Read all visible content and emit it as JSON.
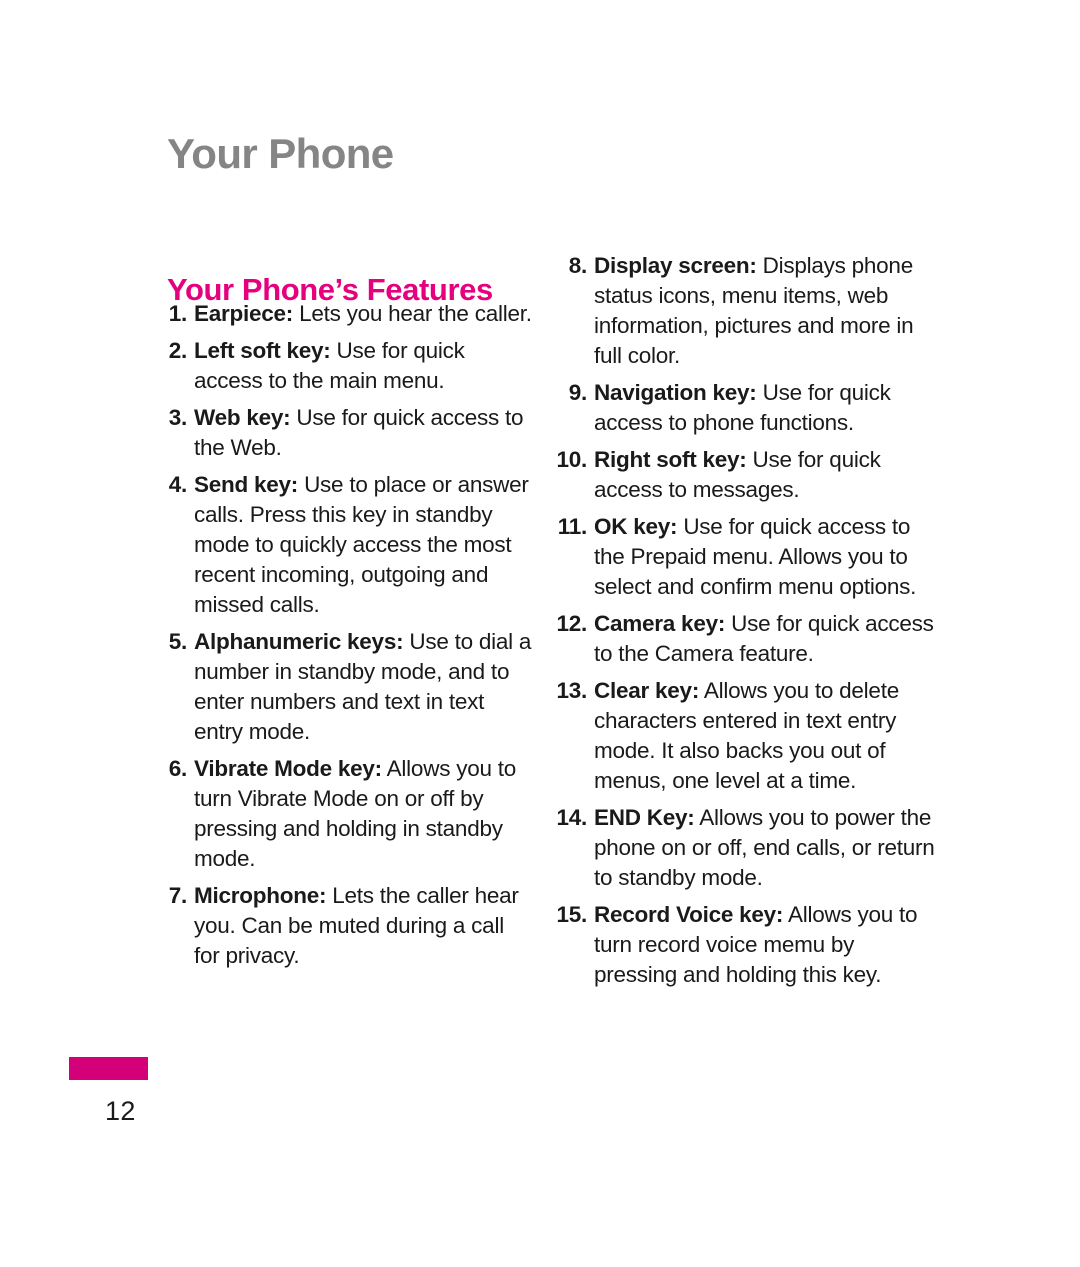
{
  "page": {
    "running_head": "Your Phone",
    "section_title": "Your Phone’s Features",
    "page_number": "12",
    "accent_color": "#e5007d",
    "rule_color": "#d4007a",
    "running_head_color": "#858585"
  },
  "columns": {
    "left": [
      {
        "num": "1.",
        "term": "Earpiece:",
        "desc": "Lets you hear the caller."
      },
      {
        "num": "2.",
        "term": "Left soft key:",
        "desc": "Use for quick access to the main menu."
      },
      {
        "num": "3.",
        "term": "Web key:",
        "desc": "Use for quick access to the Web."
      },
      {
        "num": "4.",
        "term": "Send key:",
        "desc": "Use to place or answer calls. Press this key in standby mode to quickly access the most recent incoming, outgoing and missed calls."
      },
      {
        "num": "5.",
        "term": "Alphanumeric keys:",
        "desc": "Use to dial a number in standby mode, and to enter numbers and text in text entry mode."
      },
      {
        "num": "6.",
        "term": "Vibrate Mode key:",
        "desc": "Allows you to turn Vibrate Mode on or off by pressing and holding in standby mode."
      },
      {
        "num": "7.",
        "term": "Microphone:",
        "desc": "Lets the caller hear you. Can be muted during a call for privacy."
      }
    ],
    "right": [
      {
        "num": "8.",
        "term": "Display screen:",
        "desc": "Displays phone status icons, menu items, web information, pictures and more in full color."
      },
      {
        "num": "9.",
        "term": "Navigation key:",
        "desc": "Use for quick access to phone functions."
      },
      {
        "num": "10.",
        "term": "Right soft key:",
        "desc": "Use for quick access to messages."
      },
      {
        "num": "11.",
        "term": "OK key:",
        "desc": "Use for quick access to the Prepaid menu. Allows you to select and confirm menu options."
      },
      {
        "num": "12.",
        "term": "Camera key:",
        "desc": "Use for quick access to the Camera feature."
      },
      {
        "num": "13.",
        "term": "Clear key:",
        "desc": "Allows you to delete characters entered in text entry mode. It also backs you out of menus, one level at a time."
      },
      {
        "num": "14.",
        "term": "END Key:",
        "desc": "Allows you to power the phone on or off, end calls, or return to standby mode."
      },
      {
        "num": "15.",
        "term": "Record Voice key:",
        "desc": "Allows you to turn record voice memu by pressing and holding this key."
      }
    ]
  }
}
